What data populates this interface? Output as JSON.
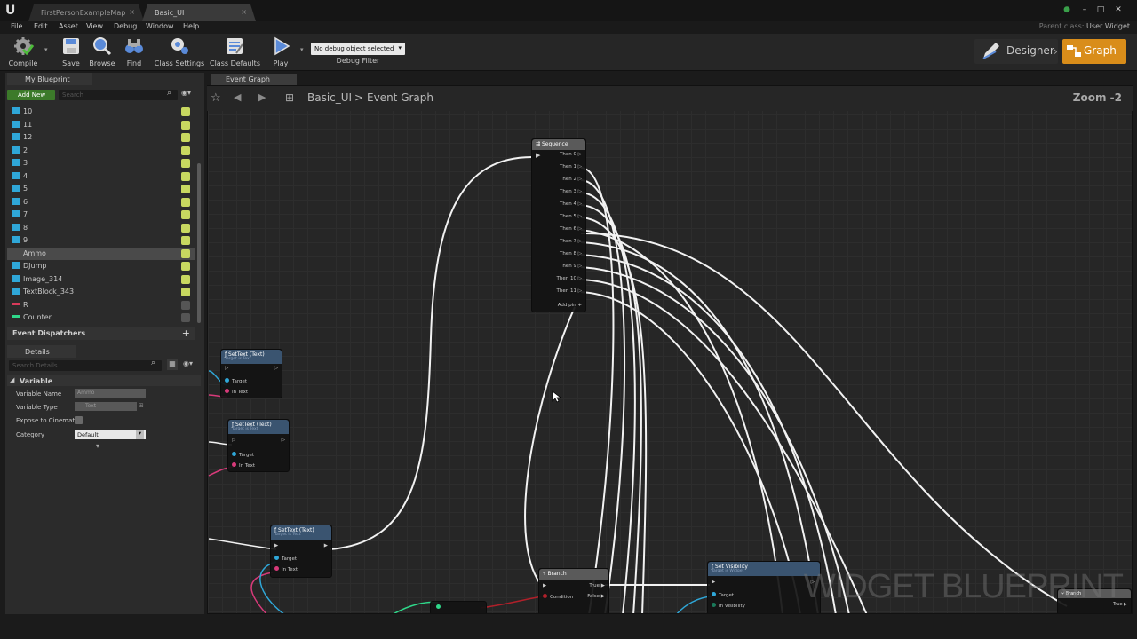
{
  "window": {
    "tabs": [
      {
        "label": "FirstPersonExampleMap"
      },
      {
        "label": "Basic_UI"
      }
    ],
    "parent_class_label": "Parent class:",
    "parent_class_value": "User Widget"
  },
  "menu": [
    "File",
    "Edit",
    "Asset",
    "View",
    "Debug",
    "Window",
    "Help"
  ],
  "toolbar": {
    "buttons": [
      {
        "label": "Compile",
        "icon": "gear-check-icon"
      },
      {
        "label": "Save",
        "icon": "save-icon"
      },
      {
        "label": "Browse",
        "icon": "magnifier-icon"
      },
      {
        "label": "Find",
        "icon": "binoculars-icon"
      },
      {
        "label": "Class Settings",
        "icon": "gears-icon"
      },
      {
        "label": "Class Defaults",
        "icon": "checklist-icon"
      },
      {
        "label": "Play",
        "icon": "play-icon"
      }
    ],
    "debug_select": "No debug object selected",
    "debug_filter": "Debug Filter",
    "mode_designer": "Designer",
    "mode_graph": "Graph"
  },
  "my_blueprint": {
    "tab": "My Blueprint",
    "add_new": "Add New",
    "search_placeholder": "Search",
    "variables": [
      {
        "name": "10",
        "kind": "widget",
        "visible": true
      },
      {
        "name": "11",
        "kind": "widget",
        "visible": true
      },
      {
        "name": "12",
        "kind": "widget",
        "visible": true
      },
      {
        "name": "2",
        "kind": "widget",
        "visible": true
      },
      {
        "name": "3",
        "kind": "widget",
        "visible": true
      },
      {
        "name": "4",
        "kind": "widget",
        "visible": true
      },
      {
        "name": "5",
        "kind": "widget",
        "visible": true
      },
      {
        "name": "6",
        "kind": "widget",
        "visible": true
      },
      {
        "name": "7",
        "kind": "widget",
        "visible": true
      },
      {
        "name": "8",
        "kind": "widget",
        "visible": true
      },
      {
        "name": "9",
        "kind": "widget",
        "visible": true
      },
      {
        "name": "Ammo",
        "kind": "widget",
        "visible": true,
        "selected": true
      },
      {
        "name": "DJump",
        "kind": "widget",
        "visible": true
      },
      {
        "name": "Image_314",
        "kind": "widget",
        "visible": true
      },
      {
        "name": "TextBlock_343",
        "kind": "widget",
        "visible": true
      },
      {
        "name": "R",
        "kind": "float",
        "visible": false
      },
      {
        "name": "Counter",
        "kind": "integer",
        "visible": false
      }
    ],
    "event_dispatchers": "Event Dispatchers"
  },
  "details": {
    "tab": "Details",
    "search_placeholder": "Search Details",
    "section": "Variable",
    "fields": [
      {
        "label": "Variable Name",
        "value": "Ammo"
      },
      {
        "label": "Variable Type",
        "value": "Text"
      },
      {
        "label": "Expose to Cinematics",
        "value": ""
      },
      {
        "label": "Category",
        "value": "Default"
      }
    ]
  },
  "graph": {
    "tab": "Event Graph",
    "breadcrumb_root": "Basic_UI",
    "breadcrumb_sep": ">",
    "breadcrumb_leaf": "Event Graph",
    "zoom": "Zoom -2",
    "watermark": "WIDGET BLUEPRINT",
    "sequence": {
      "title": "Sequence",
      "outputs": [
        "Then 0",
        "Then 1",
        "Then 2",
        "Then 3",
        "Then 4",
        "Then 5",
        "Then 6",
        "Then 7",
        "Then 8",
        "Then 9",
        "Then 10",
        "Then 11"
      ],
      "add_pin": "Add pin"
    },
    "settext_nodes": [
      {
        "title": "SetText (Text)",
        "subtitle": "Target is Text",
        "pin_target": "Target",
        "pin_text": "In Text"
      },
      {
        "title": "SetText (Text)",
        "subtitle": "Target is Text",
        "pin_target": "Target",
        "pin_text": "In Text"
      },
      {
        "title": "SetText (Text)",
        "subtitle": "Target is Text",
        "pin_target": "Target",
        "pin_text": "In Text"
      }
    ],
    "branch": {
      "title": "Branch",
      "pin_condition": "Condition",
      "pin_true": "True",
      "pin_false": "False"
    },
    "set_visibility": {
      "title": "Set Visibility",
      "subtitle": "Target is Widget",
      "pin_target": "Target",
      "pin_vis": "In Visibility"
    },
    "branch2": {
      "title": "Branch",
      "pin_true": "True"
    }
  }
}
